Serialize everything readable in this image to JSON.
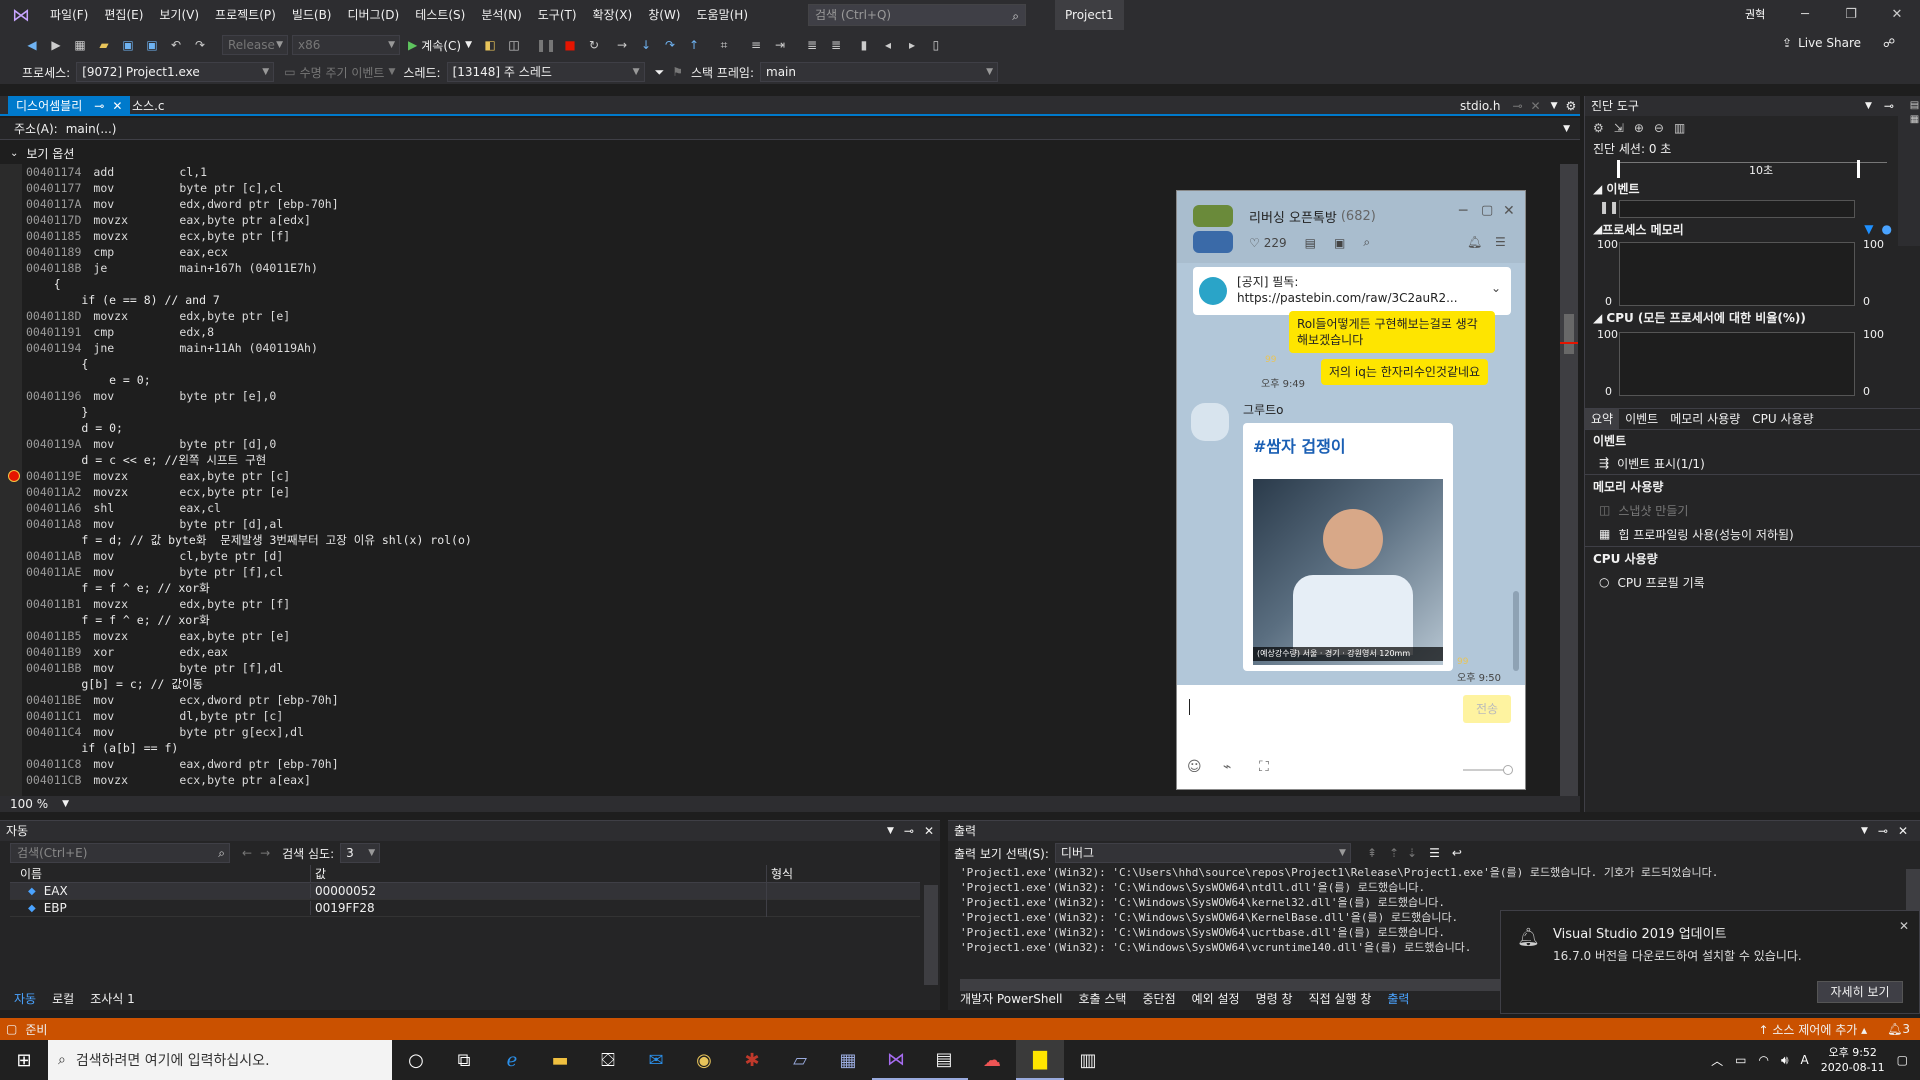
{
  "menubar": {
    "items": [
      "파일(F)",
      "편집(E)",
      "보기(V)",
      "프로젝트(P)",
      "빌드(B)",
      "디버그(D)",
      "테스트(S)",
      "분석(N)",
      "도구(T)",
      "확장(X)",
      "창(W)",
      "도움말(H)"
    ],
    "search_placeholder": "검색 (Ctrl+Q)",
    "project_title": "Project1",
    "user_badge": "권혁"
  },
  "toolbar": {
    "config": "Release",
    "platform": "x86",
    "continue_label": "계속(C)",
    "live_share": "Live Share"
  },
  "toolbar2": {
    "process_label": "프로세스:",
    "process_value": "[9072] Project1.exe",
    "lifecycle_label": "수명 주기 이벤트",
    "thread_label": "스레드:",
    "thread_value": "[13148] 주 스레드",
    "stackframe_label": "스택 프레임:",
    "stackframe_value": "main"
  },
  "tabs": {
    "active": "디스어셈블리",
    "second": "소스.c",
    "right_file": "stdio.h"
  },
  "address": {
    "label": "주소(A):",
    "value": "main(...)"
  },
  "view_options": "보기 옵션",
  "zoom": "100 %",
  "code_lines": [
    {
      "addr": "00401174",
      "op": "add",
      "arg": "cl,1"
    },
    {
      "addr": "00401177",
      "op": "mov",
      "arg": "byte ptr [c],cl"
    },
    {
      "addr": "0040117A",
      "op": "mov",
      "arg": "edx,dword ptr [ebp-70h]"
    },
    {
      "addr": "0040117D",
      "op": "movzx",
      "arg": "eax,byte ptr a[edx]"
    },
    {
      "addr": "00401185",
      "op": "movzx",
      "arg": "ecx,byte ptr [f]"
    },
    {
      "addr": "00401189",
      "op": "cmp",
      "arg": "eax,ecx"
    },
    {
      "addr": "0040118B",
      "op": "je",
      "arg": "main+167h (04011E7h)"
    },
    {
      "src": "    {"
    },
    {
      "src": "        if (e == 8) // and 7"
    },
    {
      "addr": "0040118D",
      "op": "movzx",
      "arg": "edx,byte ptr [e]"
    },
    {
      "addr": "00401191",
      "op": "cmp",
      "arg": "edx,8"
    },
    {
      "addr": "00401194",
      "op": "jne",
      "arg": "main+11Ah (040119Ah)"
    },
    {
      "src": "        {"
    },
    {
      "src": "            e = 0;"
    },
    {
      "addr": "00401196",
      "op": "mov",
      "arg": "byte ptr [e],0"
    },
    {
      "src": "        }"
    },
    {
      "src": "        d = 0;"
    },
    {
      "addr": "0040119A",
      "op": "mov",
      "arg": "byte ptr [d],0"
    },
    {
      "src": "        d = c << e; //왼쪽 시프트 구현"
    },
    {
      "addr": "0040119E",
      "op": "movzx",
      "arg": "eax,byte ptr [c]"
    },
    {
      "addr": "004011A2",
      "op": "movzx",
      "arg": "ecx,byte ptr [e]"
    },
    {
      "addr": "004011A6",
      "op": "shl",
      "arg": "eax,cl"
    },
    {
      "addr": "004011A8",
      "op": "mov",
      "arg": "byte ptr [d],al"
    },
    {
      "src": "        f = d; // 값 byte화  문제발생 3번째부터 고장 이유 shl(x) rol(o)"
    },
    {
      "addr": "004011AB",
      "op": "mov",
      "arg": "cl,byte ptr [d]"
    },
    {
      "addr": "004011AE",
      "op": "mov",
      "arg": "byte ptr [f],cl"
    },
    {
      "src": "        f = f ^ e; // xor화"
    },
    {
      "addr": "004011B1",
      "op": "movzx",
      "arg": "edx,byte ptr [f]"
    },
    {
      "src": "        f = f ^ e; // xor화"
    },
    {
      "addr": "004011B5",
      "op": "movzx",
      "arg": "eax,byte ptr [e]"
    },
    {
      "addr": "004011B9",
      "op": "xor",
      "arg": "edx,eax"
    },
    {
      "addr": "004011BB",
      "op": "mov",
      "arg": "byte ptr [f],dl"
    },
    {
      "src": "        g[b] = c; // 값이동"
    },
    {
      "addr": "004011BE",
      "op": "mov",
      "arg": "ecx,dword ptr [ebp-70h]"
    },
    {
      "addr": "004011C1",
      "op": "mov",
      "arg": "dl,byte ptr [c]"
    },
    {
      "addr": "004011C4",
      "op": "mov",
      "arg": "byte ptr g[ecx],dl"
    },
    {
      "src": "        if (a[b] == f)"
    },
    {
      "addr": "004011C8",
      "op": "mov",
      "arg": "eax,dword ptr [ebp-70h]"
    },
    {
      "addr": "004011CB",
      "op": "movzx",
      "arg": "ecx,byte ptr a[eax]"
    }
  ],
  "diag": {
    "title": "진단 도구",
    "session": "진단 세션: 0 초",
    "ruler": "10초",
    "events": "이벤트",
    "process_memory": "프로세스 메모리",
    "mem_max": "100",
    "mem_min": "0",
    "cpu_title": "CPU (모든 프로세서에 대한 비율(%))",
    "tabs": [
      "요약",
      "이벤트",
      "메모리 사용량",
      "CPU 사용량"
    ],
    "sec_events": "이벤트",
    "show_events": "이벤트 표시(1/1)",
    "sec_memory": "메모리 사용량",
    "snapshot": "스냅샷 만들기",
    "heap": "힙 프로파일링 사용(성능이 저하됨)",
    "sec_cpu": "CPU 사용량",
    "cpu_record": "CPU 프로필 기록"
  },
  "auto_panel": {
    "title": "자동",
    "search_placeholder": "검색(Ctrl+E)",
    "depth_label": "검색 심도:",
    "depth_value": "3",
    "cols": [
      "이름",
      "값",
      "형식"
    ],
    "rows": [
      {
        "name": "EAX",
        "value": "00000052"
      },
      {
        "name": "EBP",
        "value": "0019FF28"
      }
    ],
    "tabs": [
      "자동",
      "로컬",
      "조사식 1"
    ]
  },
  "output_panel": {
    "title": "출력",
    "source_label": "출력 보기 선택(S):",
    "source_value": "디버그",
    "lines": [
      "'Project1.exe'(Win32): 'C:\\Users\\hhd\\source\\repos\\Project1\\Release\\Project1.exe'을(를) 로드했습니다. 기호가 로드되었습니다.",
      "'Project1.exe'(Win32): 'C:\\Windows\\SysWOW64\\ntdll.dll'을(를) 로드했습니다.",
      "'Project1.exe'(Win32): 'C:\\Windows\\SysWOW64\\kernel32.dll'을(를) 로드했습니다.",
      "'Project1.exe'(Win32): 'C:\\Windows\\SysWOW64\\KernelBase.dll'을(를) 로드했습니다.",
      "'Project1.exe'(Win32): 'C:\\Windows\\SysWOW64\\ucrtbase.dll'을(를) 로드했습니다.",
      "'Project1.exe'(Win32): 'C:\\Windows\\SysWOW64\\vcruntime140.dll'을(를) 로드했습니다."
    ],
    "tabs": [
      "개발자 PowerShell",
      "호출 스택",
      "중단점",
      "예외 설정",
      "명령 창",
      "직접 실행 창",
      "출력"
    ]
  },
  "toast": {
    "title": "Visual Studio 2019 업데이트",
    "body": "16.7.0 버전을 다운로드하여 설치할 수 있습니다.",
    "button": "자세히 보기"
  },
  "status": {
    "ready": "준비",
    "source_control": "소스 제어에 추가",
    "notif_count": "3"
  },
  "taskbar": {
    "search_placeholder": "검색하려면 여기에 입력하십시오.",
    "time": "오후 9:52",
    "date": "2020-08-11",
    "ime": "A"
  },
  "kakao": {
    "room_name": "리버싱 오픈톡방",
    "member_count": "(682)",
    "likes": "229",
    "notice_label": "[공지] 필독:",
    "notice_url": "https://pastebin.com/raw/3C2auR2...",
    "msg1": "Rol들어떻게든 구현해보는걸로 생각해보겠습니다",
    "msg2_time": "오후 9:49",
    "msg2_unread": "99",
    "msg2": "저의 iq는 한자리수인것같네요",
    "sender": "그루트o",
    "card_title": "#쌈자 겁쟁이",
    "img_caption": "(예상강수량) 서울 · 경기 · 강원영서 120mm",
    "msg3_time": "오후 9:50",
    "msg3_unread": "99",
    "send_label": "전송"
  }
}
